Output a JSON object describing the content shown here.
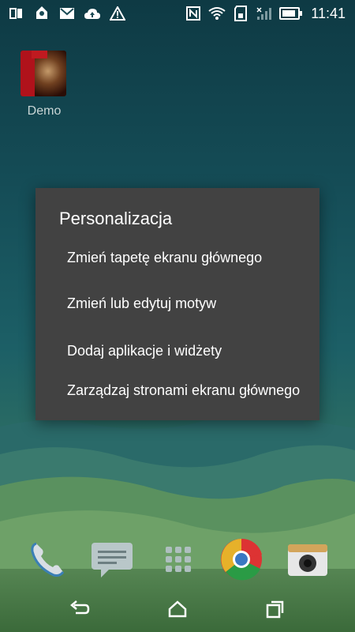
{
  "status_bar": {
    "time": "11:41",
    "left_icons": [
      "screen-share-icon",
      "location-pin-icon",
      "gmail-icon",
      "cloud-upload-icon",
      "warning-icon"
    ],
    "right_icons": [
      "nfc-icon",
      "wifi-icon",
      "sd-card-icon",
      "signal-icon",
      "battery-icon"
    ]
  },
  "home": {
    "app_label": "Demo"
  },
  "dialog": {
    "title": "Personalizacja",
    "items": [
      "Zmień tapetę ekranu głównego",
      "Zmień lub edytuj motyw",
      "Dodaj aplikacje i widżety",
      "Zarządzaj stronami ekranu głównego"
    ]
  },
  "dock": {
    "icons": [
      "phone-icon",
      "messages-icon",
      "app-drawer-icon",
      "chrome-icon",
      "camera-icon"
    ]
  },
  "nav": {
    "icons": [
      "back-icon",
      "home-icon",
      "recents-icon"
    ]
  }
}
